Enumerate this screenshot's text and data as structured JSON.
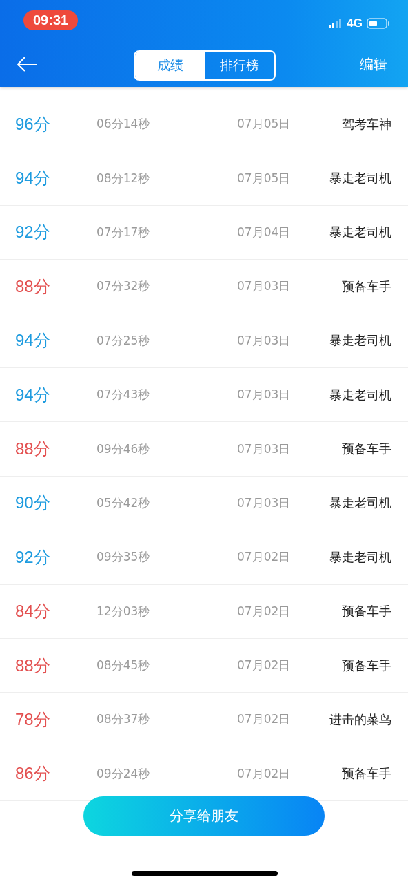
{
  "status_bar": {
    "time": "09:31",
    "network": "4G"
  },
  "nav": {
    "tabs": [
      {
        "label": "成绩",
        "selected": true
      },
      {
        "label": "排行榜",
        "selected": false
      }
    ],
    "edit": "编辑"
  },
  "records": [
    {
      "score": "96分",
      "passed": true,
      "duration": "06分14秒",
      "date": "07月05日",
      "title": "驾考车神"
    },
    {
      "score": "94分",
      "passed": true,
      "duration": "08分12秒",
      "date": "07月05日",
      "title": "暴走老司机"
    },
    {
      "score": "92分",
      "passed": true,
      "duration": "07分17秒",
      "date": "07月04日",
      "title": "暴走老司机"
    },
    {
      "score": "88分",
      "passed": false,
      "duration": "07分32秒",
      "date": "07月03日",
      "title": "预备车手"
    },
    {
      "score": "94分",
      "passed": true,
      "duration": "07分25秒",
      "date": "07月03日",
      "title": "暴走老司机"
    },
    {
      "score": "94分",
      "passed": true,
      "duration": "07分43秒",
      "date": "07月03日",
      "title": "暴走老司机"
    },
    {
      "score": "88分",
      "passed": false,
      "duration": "09分46秒",
      "date": "07月03日",
      "title": "预备车手"
    },
    {
      "score": "90分",
      "passed": true,
      "duration": "05分42秒",
      "date": "07月03日",
      "title": "暴走老司机"
    },
    {
      "score": "92分",
      "passed": true,
      "duration": "09分35秒",
      "date": "07月02日",
      "title": "暴走老司机"
    },
    {
      "score": "84分",
      "passed": false,
      "duration": "12分03秒",
      "date": "07月02日",
      "title": "预备车手"
    },
    {
      "score": "88分",
      "passed": false,
      "duration": "08分45秒",
      "date": "07月02日",
      "title": "预备车手"
    },
    {
      "score": "78分",
      "passed": false,
      "duration": "08分37秒",
      "date": "07月02日",
      "title": "进击的菜鸟"
    },
    {
      "score": "86分",
      "passed": false,
      "duration": "09分24秒",
      "date": "07月02日",
      "title": "预备车手"
    }
  ],
  "share_button": "分享给朋友"
}
